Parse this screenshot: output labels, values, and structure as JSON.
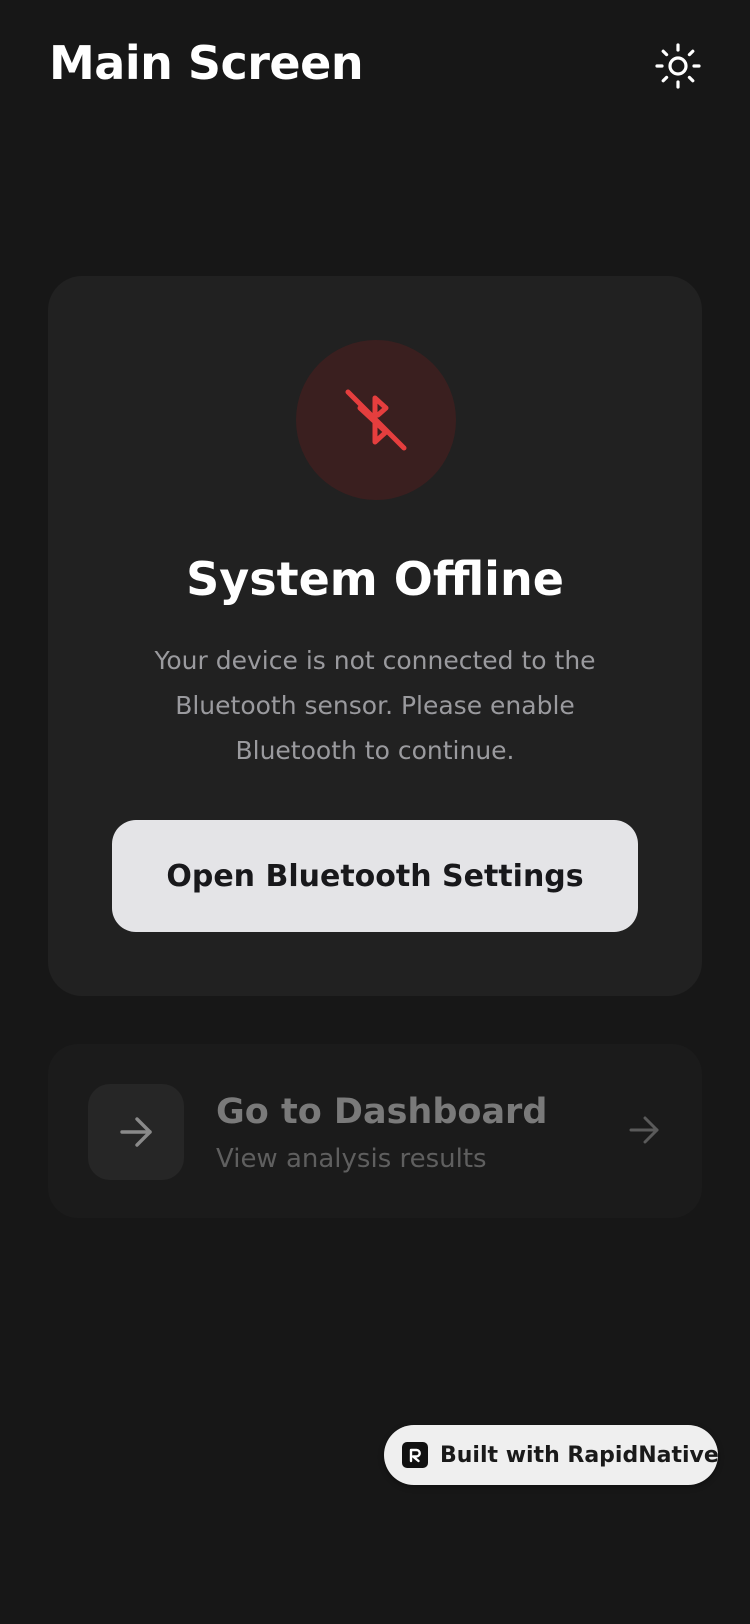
{
  "header": {
    "title": "Main Screen",
    "theme_icon": "sun-icon"
  },
  "status_card": {
    "icon": "bluetooth-off-icon",
    "title": "System Offline",
    "message": "Your device is not connected to the Bluetooth sensor. Please enable Bluetooth to continue.",
    "button_label": "Open Bluetooth Settings",
    "accent_color": "#e53e3e"
  },
  "dashboard_card": {
    "icon": "arrow-right-icon",
    "title": "Go to Dashboard",
    "subtitle": "View analysis results",
    "chevron_icon": "arrow-right-icon"
  },
  "badge": {
    "logo_icon": "rapidnative-logo-icon",
    "label": "Built with RapidNative"
  }
}
